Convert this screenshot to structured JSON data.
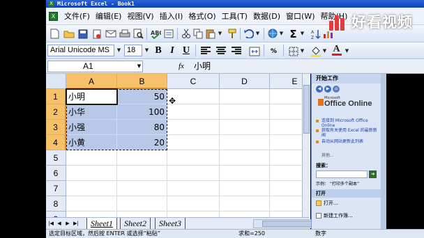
{
  "window": {
    "title": "Microsoft Excel - Book1"
  },
  "menu": {
    "items": [
      "文件(F)",
      "编辑(E)",
      "视图(V)",
      "插入(I)",
      "格式(O)",
      "工具(T)",
      "数据(D)",
      "窗口(W)",
      "帮助(H)"
    ]
  },
  "watermark": {
    "text": "好看视频"
  },
  "toolbar": {
    "font_name": "Arial Unicode MS",
    "font_size": "18",
    "bold": "B",
    "italic": "I",
    "underline": "U",
    "font_color_letter": "A",
    "sigma": "Σ"
  },
  "formula_bar": {
    "name_box": "A1",
    "fx": "fx",
    "content": "小明"
  },
  "sheet": {
    "columns": [
      "A",
      "B",
      "C",
      "D",
      "E"
    ],
    "rows": [
      "1",
      "2",
      "3",
      "4",
      "5",
      "6",
      "7",
      "8",
      "9"
    ],
    "cells": [
      {
        "name": "小明",
        "value": "50"
      },
      {
        "name": "小华",
        "value": "100"
      },
      {
        "name": "小强",
        "value": "80"
      },
      {
        "name": "小黄",
        "value": "20"
      }
    ],
    "tabs": [
      "Sheet1",
      "Sheet2",
      "Sheet3"
    ]
  },
  "status": {
    "message": "选定目标区域，然后按 ENTER 或选择“粘贴”",
    "sum": "求和=250",
    "mode": "数字"
  },
  "task_pane": {
    "title": "开始工作",
    "logo_small": "Microsoft",
    "logo": "Office Online",
    "links": [
      "连接到 Microsoft Office Online",
      "获取有关使用 Excel 的最新新闻",
      "自动从网站更新此列表"
    ],
    "more": "其他...",
    "search_label": "搜索：",
    "example": "示例：  “打印多个副本”",
    "open_section": "打开",
    "open_more": "打开...",
    "new_workbook": "新建工作簿..."
  },
  "colors": {
    "title_bar": "#0a3fb8",
    "selection": "#b7c9e7",
    "header_selected": "#f7c16a"
  }
}
